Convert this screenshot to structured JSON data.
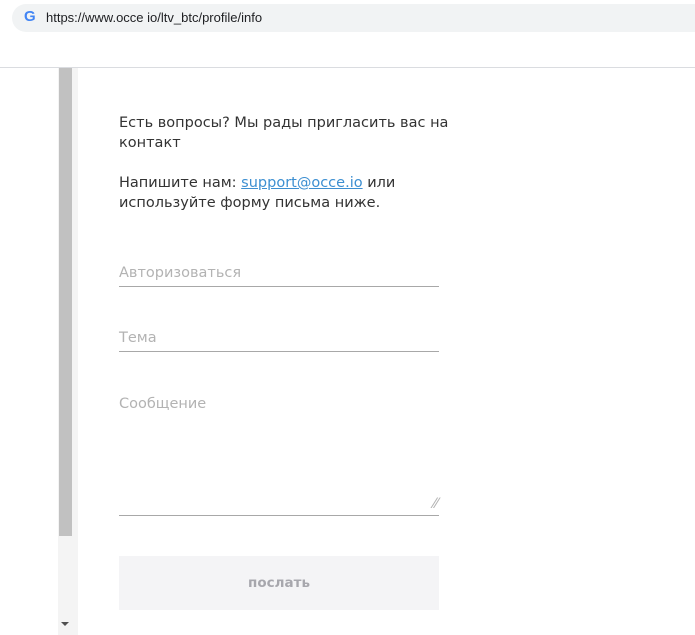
{
  "browser": {
    "url": "https://www.occe io/ltv_btc/profile/info",
    "logo": "G"
  },
  "content": {
    "intro": "Есть вопросы? Мы рады пригласить вас на контакт",
    "write_prefix": "Напишите нам: ",
    "email": "support@occe.io",
    "write_suffix": " или используйте форму письма ниже."
  },
  "form": {
    "login_placeholder": "Авторизоваться",
    "subject_placeholder": "Тема",
    "message_placeholder": "Сообщение",
    "submit_label": "послать"
  }
}
